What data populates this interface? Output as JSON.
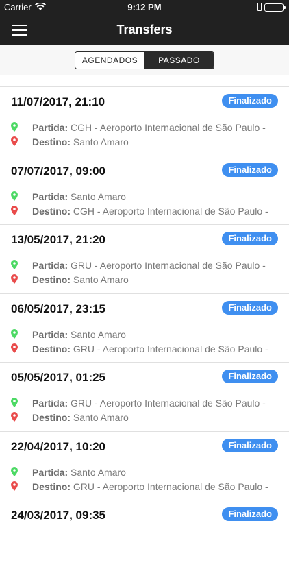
{
  "status_bar": {
    "carrier": "Carrier",
    "time": "9:12 PM"
  },
  "nav": {
    "title": "Transfers"
  },
  "segments": {
    "scheduled": "AGENDADOS",
    "past": "PASSADO",
    "selected": "PASSADO"
  },
  "labels": {
    "origin": "Partida:",
    "destination": "Destino:"
  },
  "colors": {
    "nav_bg": "#212121",
    "badge": "#3f8ff0",
    "origin_pin": "#4cd964",
    "destination_pin": "#e94b4b"
  },
  "transfers": [
    {
      "datetime": "11/07/2017, 21:10",
      "status": "Finalizado",
      "origin": "CGH - Aeroporto Internacional de São Paulo -",
      "destination": "Santo Amaro"
    },
    {
      "datetime": "07/07/2017, 09:00",
      "status": "Finalizado",
      "origin": "Santo Amaro",
      "destination": "CGH - Aeroporto Internacional de São Paulo -"
    },
    {
      "datetime": "13/05/2017, 21:20",
      "status": "Finalizado",
      "origin": "GRU - Aeroporto Internacional de São Paulo -",
      "destination": "Santo Amaro"
    },
    {
      "datetime": "06/05/2017, 23:15",
      "status": "Finalizado",
      "origin": "Santo Amaro",
      "destination": "GRU - Aeroporto Internacional de São Paulo -"
    },
    {
      "datetime": "05/05/2017, 01:25",
      "status": "Finalizado",
      "origin": "GRU - Aeroporto Internacional de São Paulo -",
      "destination": "Santo Amaro"
    },
    {
      "datetime": "22/04/2017, 10:20",
      "status": "Finalizado",
      "origin": "Santo Amaro",
      "destination": "GRU - Aeroporto Internacional de São Paulo -"
    },
    {
      "datetime": "24/03/2017, 09:35",
      "status": "Finalizado",
      "origin": "",
      "destination": ""
    }
  ]
}
